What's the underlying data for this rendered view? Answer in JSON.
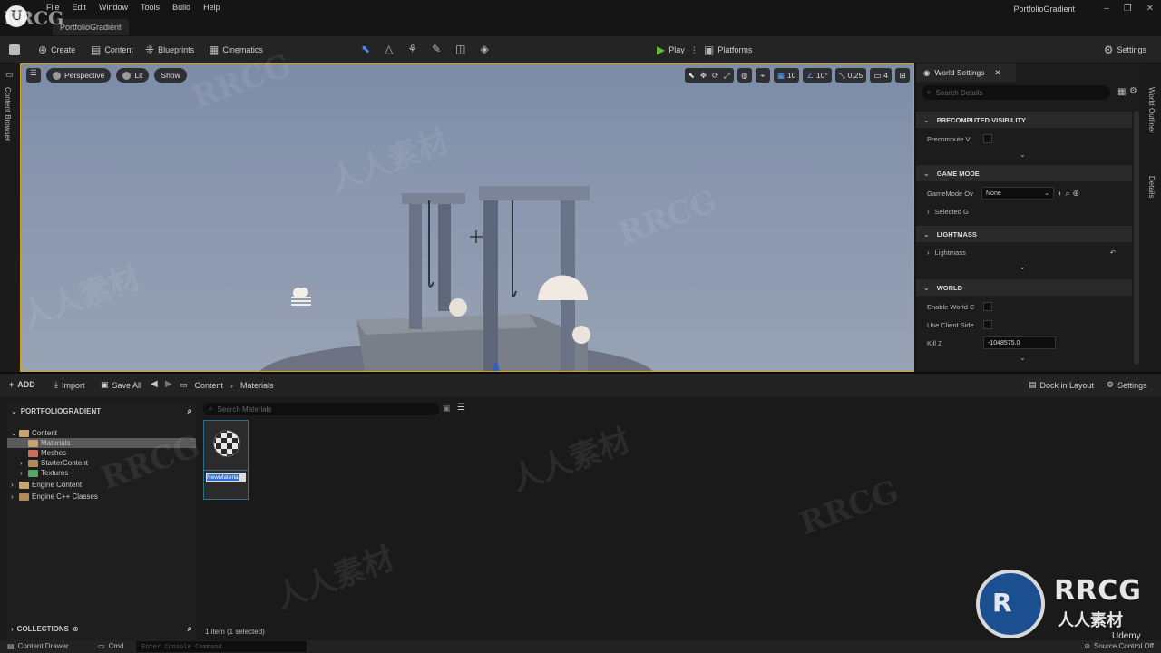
{
  "watermark": {
    "brand": "RRCG",
    "cn": "人人素材",
    "corner_logo_text": "RRCG",
    "corner_logo_sub": "人人素材",
    "udemy": "Udemy"
  },
  "menu": {
    "items": [
      "File",
      "Edit",
      "Window",
      "Tools",
      "Build",
      "Help"
    ]
  },
  "project_tab": "PortfolioGradient",
  "window_title": "PortfolioGradient",
  "toolbar": {
    "save_icon": "save-icon",
    "create": "Create",
    "content": "Content",
    "blueprints": "Blueprints",
    "cinematics": "Cinematics",
    "play": "Play",
    "platforms": "Platforms",
    "settings": "Settings"
  },
  "left_vtab": "Content Browser",
  "viewport": {
    "perspective": "Perspective",
    "lit": "Lit",
    "show": "Show",
    "grid_snap": "10",
    "rot_snap": "10°",
    "scale_snap": "0.25",
    "camera_speed": "4"
  },
  "world_settings": {
    "tab": "World Settings",
    "search_placeholder": "Search Details",
    "sections": {
      "precomputed_visibility": "PRECOMPUTED VISIBILITY",
      "game_mode": "GAME MODE",
      "lightmass": "LIGHTMASS",
      "world": "WORLD"
    },
    "props": {
      "precompute_v": "Precompute V",
      "gamemode_ov": "GameMode Ov",
      "gamemode_value": "None",
      "selected_g": "Selected G",
      "lightmass": "Lightmass",
      "enable_world": "Enable World C",
      "use_client_side": "Use Client Side",
      "kill_z": "Kill Z",
      "kill_z_value": "-1048575.0"
    }
  },
  "right_vtabs": {
    "world_outliner": "World Outliner",
    "details": "Details"
  },
  "content_browser": {
    "add": "ADD",
    "import": "Import",
    "save_all": "Save All",
    "breadcrumb": [
      "Content",
      "Materials"
    ],
    "dock_in_layout": "Dock in Layout",
    "settings": "Settings",
    "root": "PORTFOLIOGRADIENT",
    "tree": [
      {
        "label": "Content",
        "indent": 1,
        "color": "orange",
        "expanded": true
      },
      {
        "label": "Materials",
        "indent": 2,
        "color": "orange",
        "selected": true
      },
      {
        "label": "Meshes",
        "indent": 2,
        "color": "red"
      },
      {
        "label": "StarterContent",
        "indent": 2,
        "color": "brown",
        "collapsed": true
      },
      {
        "label": "Textures",
        "indent": 2,
        "color": "green",
        "collapsed": true
      },
      {
        "label": "Engine Content",
        "indent": 1,
        "color": "orange",
        "collapsed": true
      },
      {
        "label": "Engine C++ Classes",
        "indent": 1,
        "color": "brown",
        "collapsed": true
      }
    ],
    "collections": "COLLECTIONS",
    "search_placeholder": "Search Materials",
    "asset_name_editing": "NewMaterial",
    "item_count": "1 item (1 selected)"
  },
  "statusbar": {
    "content_drawer": "Content Drawer",
    "cmd": "Cmd",
    "console_placeholder": "Enter Console Command",
    "source_control": "Source Control Off"
  }
}
